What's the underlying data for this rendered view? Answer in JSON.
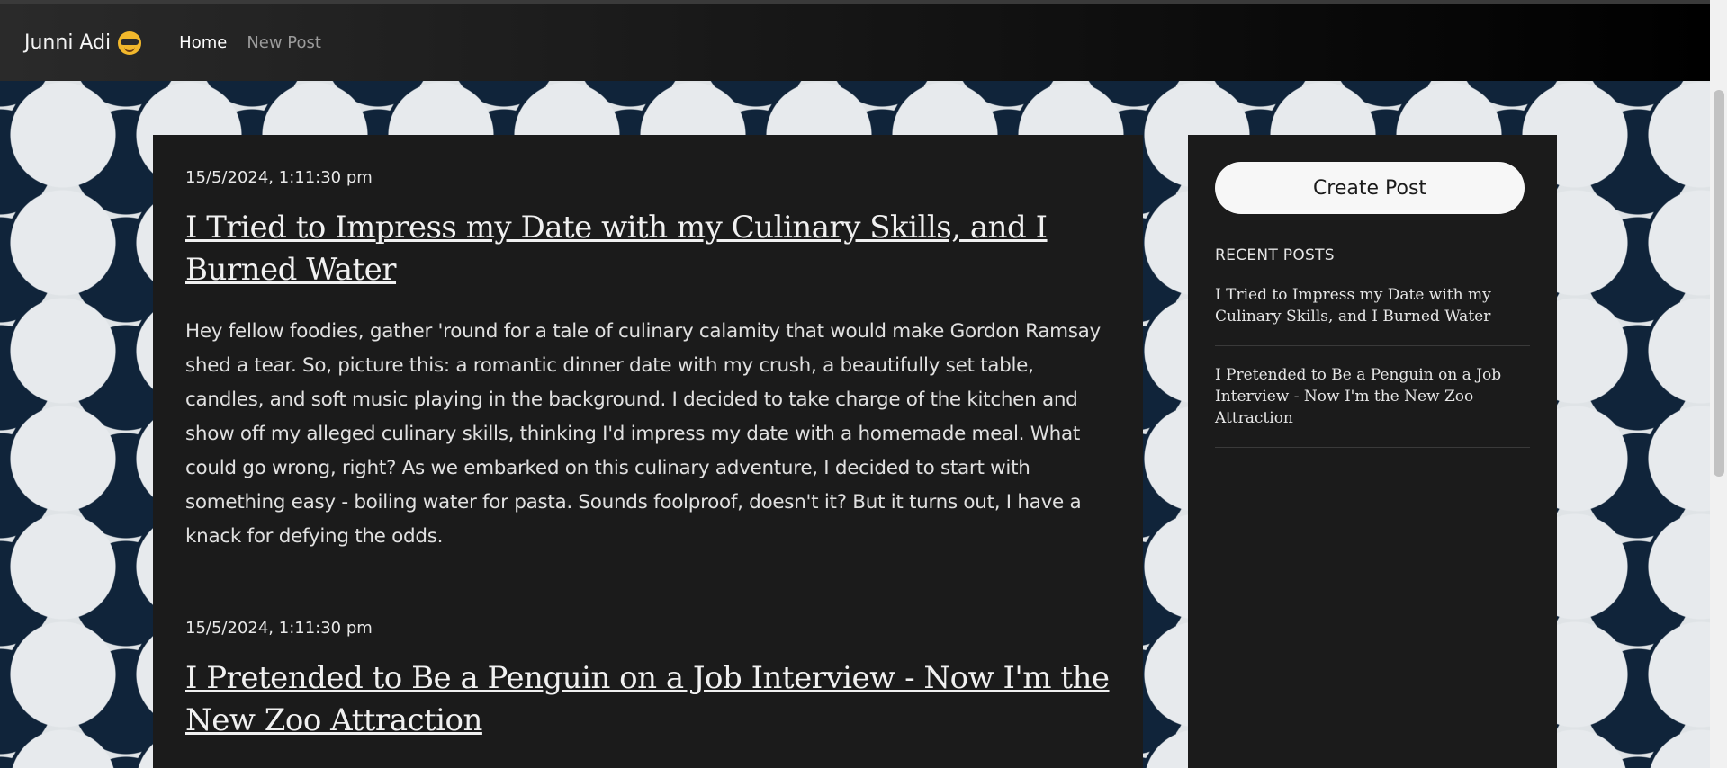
{
  "navbar": {
    "brand": "Junni Adi",
    "brand_icon": "sunglasses-emoji-icon",
    "links": [
      {
        "label": "Home"
      },
      {
        "label": "New Post"
      }
    ]
  },
  "posts": [
    {
      "date": "15/5/2024, 1:11:30 pm",
      "title": "I Tried to Impress my Date with my Culinary Skills, and I Burned Water",
      "body": "Hey fellow foodies, gather 'round for a tale of culinary calamity that would make Gordon Ramsay shed a tear. So, picture this: a romantic dinner date with my crush, a beautifully set table, candles, and soft music playing in the background. I decided to take charge of the kitchen and show off my alleged culinary skills, thinking I'd impress my date with a homemade meal. What could go wrong, right? As we embarked on this culinary adventure, I decided to start with something easy - boiling water for pasta. Sounds foolproof, doesn't it? But it turns out, I have a knack for defying the odds."
    },
    {
      "date": "15/5/2024, 1:11:30 pm",
      "title": "I Pretended to Be a Penguin on a Job Interview - Now I'm the New Zoo Attraction"
    }
  ],
  "sidebar": {
    "create_button": "Create Post",
    "recent_heading": "RECENT POSTS",
    "recent_posts": [
      "I Tried to Impress my Date with my Culinary Skills, and I Burned Water",
      "I Pretended to Be a Penguin on a Job Interview - Now I'm the New Zoo Attraction"
    ]
  },
  "colors": {
    "navbar_start": "#2a2a2a",
    "navbar_end": "#000000",
    "panel": "#1b1b1b",
    "button": "#f7f7f7"
  }
}
